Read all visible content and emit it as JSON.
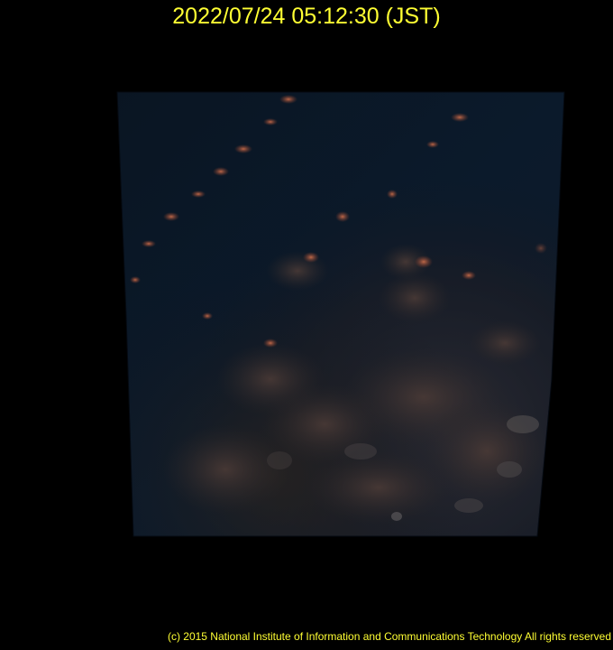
{
  "timestamp": "2022/07/24 05:12:30 (JST)",
  "copyright": "(c) 2015 National Institute of Information and Communications Technology All rights reserved",
  "colors": {
    "background": "#000000",
    "text": "#ffff33",
    "frame_edge": "#050a12",
    "night_sea": "#0a1725",
    "cloud_shadow": "#1a1b22",
    "dawn_cloud": "#c0684b"
  }
}
